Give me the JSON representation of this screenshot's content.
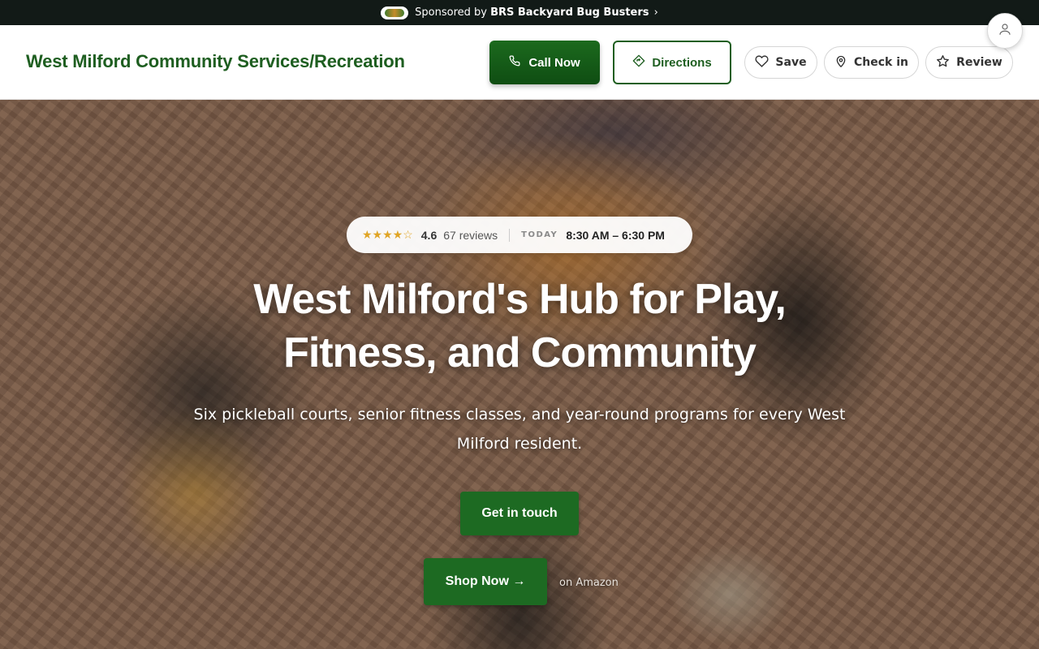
{
  "sponsor": {
    "prefix": "Sponsored by",
    "name": "BRS Backyard Bug Busters",
    "arrow": "›"
  },
  "header": {
    "brand": "West Milford Community Services/Recreation",
    "call_label": "Call Now",
    "directions_label": "Directions",
    "save_label": "Save",
    "checkin_label": "Check in",
    "review_label": "Review"
  },
  "hero": {
    "stars": "★★★★☆",
    "rating": "4.6",
    "reviews": "67 reviews",
    "today_label": "TODAY",
    "hours": "8:30 AM – 6:30 PM",
    "title": "West Milford's Hub for Play, Fitness, and Community",
    "subtitle": "Six pickleball courts, senior fitness classes, and year-round programs for every West Milford resident.",
    "cta_label": "Get in touch",
    "shop_label": "Shop Now →",
    "shop_note": "on Amazon"
  },
  "colors": {
    "brand_green": "#1e5e20",
    "button_green": "#1d6a22",
    "star_gold": "#e0a526",
    "sponsor_bar": "#121a17"
  },
  "icons": [
    "phone-icon",
    "directions-icon",
    "heart-icon",
    "map-pin-icon",
    "star-icon",
    "user-icon",
    "sponsor-logo"
  ]
}
